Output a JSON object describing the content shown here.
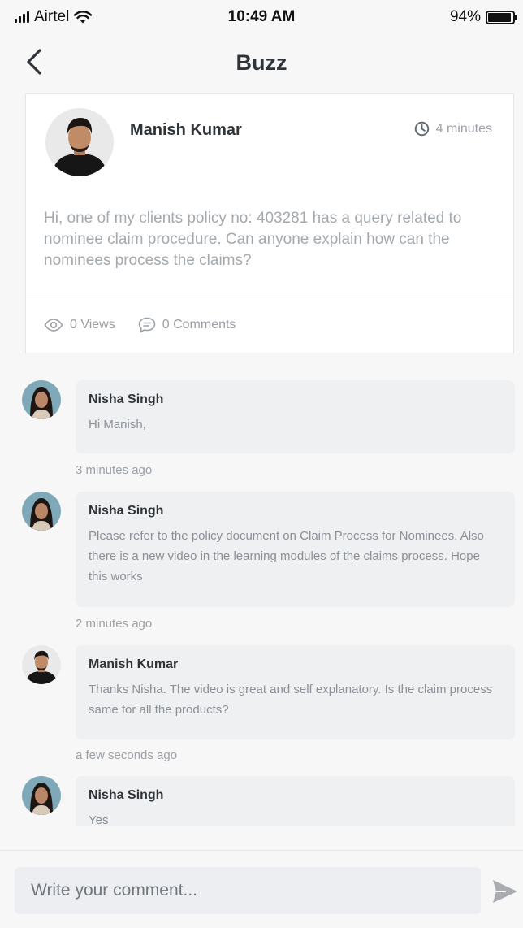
{
  "status_bar": {
    "carrier": "Airtel",
    "time": "10:49 AM",
    "battery_percent": "94%",
    "battery_level": 0.94
  },
  "header": {
    "title": "Buzz",
    "back_icon": "chevron-left-icon"
  },
  "post": {
    "author": "Manish Kumar",
    "time": "4 minutes",
    "time_icon": "clock-icon",
    "body": "Hi, one of my clients policy no: 403281 has a query related to nominee claim procedure. Can anyone explain how can the nominees process the claims?",
    "views_label": "0 Views",
    "views_icon": "eye-icon",
    "comments_label": "0 Comments",
    "comments_icon": "comment-icon"
  },
  "comments": [
    {
      "author": "Nisha Singh",
      "text": "Hi Manish,",
      "time": "3 minutes ago"
    },
    {
      "author": "Nisha Singh",
      "text": "Please refer to the policy document on Claim Process for Nominees. Also there is a new video in the learning modules of the claims process. Hope this works",
      "time": "2 minutes ago"
    },
    {
      "author": "Manish Kumar",
      "text": "Thanks Nisha. The video is great and self explanatory. Is the claim process same for all the products?",
      "time": "a few seconds ago"
    },
    {
      "author": "Nisha Singh",
      "text": "Yes",
      "time": ""
    }
  ],
  "composer": {
    "placeholder": "Write your comment...",
    "send_icon": "send-icon"
  },
  "colors": {
    "background": "#f7f7f8",
    "bubble": "#eff0f2",
    "text_dark": "#2f3439",
    "text_muted": "#9aa0a6"
  }
}
